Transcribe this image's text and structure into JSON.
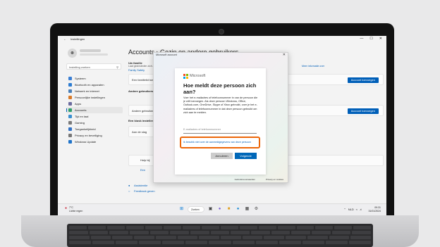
{
  "settings": {
    "window_title": "Instellingen",
    "back_glyph": "←",
    "window_controls": [
      "—",
      "☐",
      "✕"
    ],
    "search_placeholder": "Instelling zoeken",
    "nav_items": [
      {
        "label": "Systeem",
        "color": "#3b7fd4",
        "active": false
      },
      {
        "label": "Bluetooth en apparaten",
        "color": "#2d7cd1",
        "active": false
      },
      {
        "label": "Netwerk en internet",
        "color": "#4a7fb8",
        "active": false
      },
      {
        "label": "Persoonlijke instellingen",
        "color": "#d87a2a",
        "active": false
      },
      {
        "label": "Apps",
        "color": "#6b6b9e",
        "active": false
      },
      {
        "label": "Accounts",
        "color": "#2f9e6a",
        "active": true
      },
      {
        "label": "Tijd en taal",
        "color": "#3a8fd0",
        "active": false
      },
      {
        "label": "Gaming",
        "color": "#7a7a7a",
        "active": false
      },
      {
        "label": "Toegankelijkheid",
        "color": "#3372c4",
        "active": false
      },
      {
        "label": "Privacy en beveiliging",
        "color": "#777777",
        "active": false
      },
      {
        "label": "Windows Update",
        "color": "#1f73c9",
        "active": false
      }
    ],
    "page_title": "Accounts  ›  Gezin en andere gebruikers",
    "family_heading": "Uw familie",
    "family_text": "Laat gezinsleden zich aanmelden bij deze pc. Volwassenen kunnen",
    "family_link": "Family Safety",
    "more_info_link": "Meer informatie over",
    "family_card_label": "Een familielid toevoegen",
    "add_account_button": "Account toevoegen",
    "other_users_heading": "Andere gebruikers",
    "other_users_card_label": "Andere gebruiker toevoegen",
    "kiosk_heading": "Een kiosk instellen",
    "kiosk_label": "Aan de slag",
    "help_label": "Hulp bij",
    "help_link": "Een",
    "assistance_link": "Assistentie",
    "feedback_link": "Feedback geven"
  },
  "dialog": {
    "window_title": "Microsoft account",
    "close_glyph": "✕",
    "brand": "Microsoft",
    "heading": "Hoe meldt deze persoon zich aan?",
    "body": "Voer het e-mailadres of telefoonnummer in van de persoon die je wilt toevoegen. Als deze persoon Windows, Office, Outlook.com, OneDrive, Skype of Xbox gebruikt, voer je het e-mailadres of telefoonnummer in dat deze persoon gebruikt om zich aan te melden.",
    "input_placeholder": "E-mailadres of telefoonnummer",
    "no_signin_link": "Ik beschik niet over de aanmeldgegevens van deze persoon",
    "cancel_button": "Annuleren",
    "next_button": "Volgende",
    "footer_terms": "Gebruiksvoorwaarden",
    "footer_privacy": "Privacy en cookies",
    "highlight_color": "#ec6608"
  },
  "taskbar": {
    "weather_temp": "7°C",
    "weather_desc": "Lichte regen",
    "search_label": "Zoeken",
    "tray_lang": "NLD",
    "time": "09:31",
    "date": "31/01/2024"
  }
}
